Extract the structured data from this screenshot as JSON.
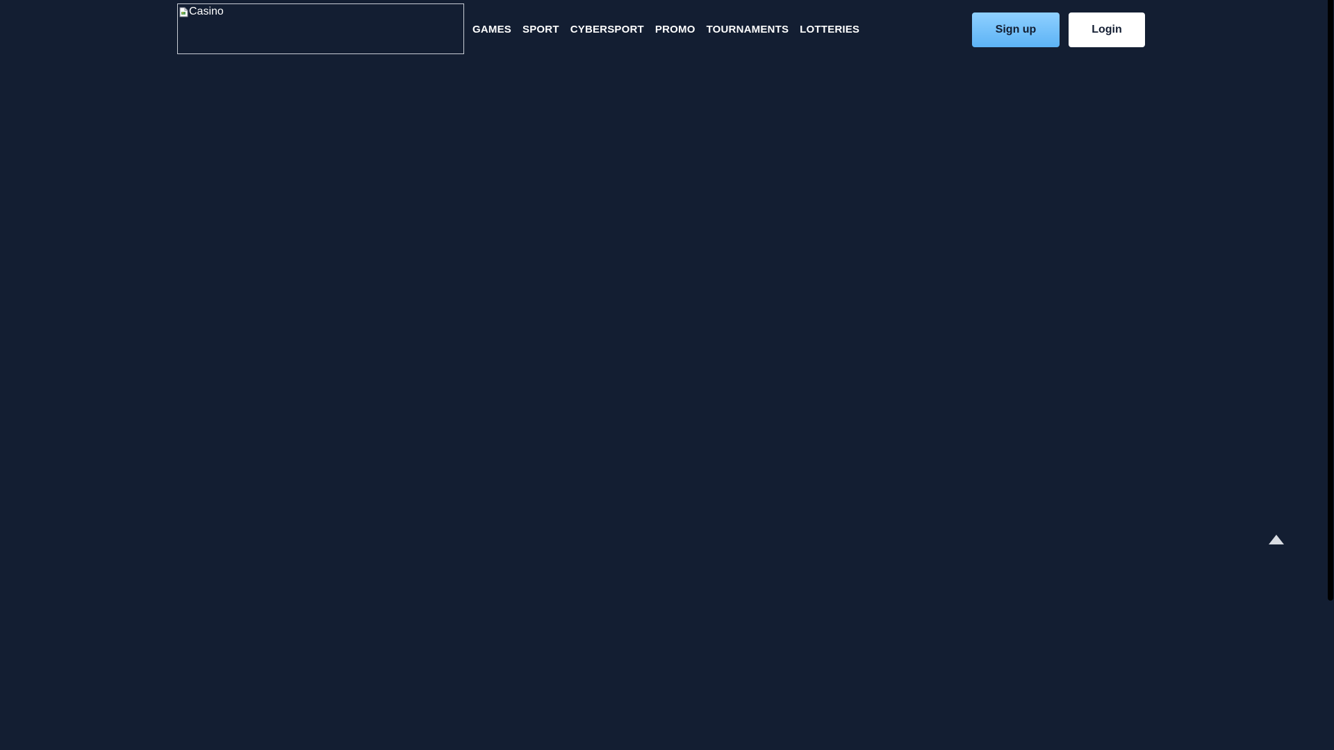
{
  "header": {
    "logo": {
      "alt_text": "Casino",
      "icon": "broken-image-icon"
    },
    "nav": {
      "items": [
        {
          "label": "GAMES"
        },
        {
          "label": "SPORT"
        },
        {
          "label": "CYBERSPORT"
        },
        {
          "label": "PROMO"
        },
        {
          "label": "TOURNAMENTS"
        },
        {
          "label": "LOTTERIES"
        }
      ]
    },
    "auth": {
      "signup_label": "Sign up",
      "login_label": "Login"
    }
  },
  "scroll_top": {
    "icon": "triangle-up-icon"
  },
  "colors": {
    "background": "#131e32",
    "signup_button": "#7cc4fb",
    "login_button": "#ffffff",
    "nav_text": "#ffffff"
  }
}
